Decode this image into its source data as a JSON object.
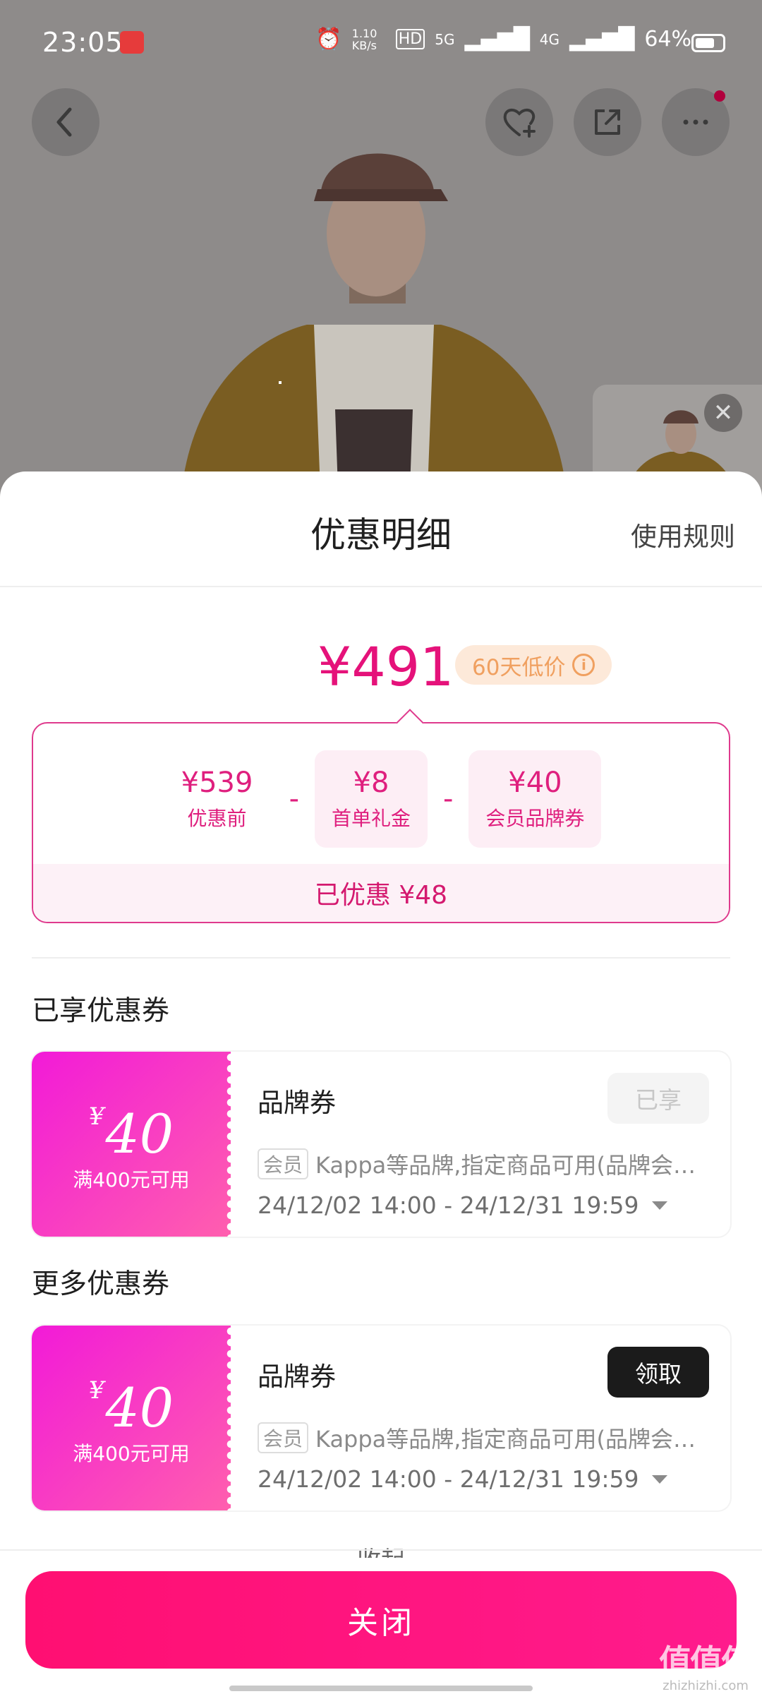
{
  "status_bar": {
    "time": "23:05",
    "net_speed": "1.10 KB/s",
    "network_labels": [
      "HD",
      "5G",
      "4G"
    ],
    "battery": "64%"
  },
  "header_icons": [
    "back-icon",
    "favorite-add-icon",
    "share-icon",
    "more-icon"
  ],
  "thumbnail": {
    "close_glyph": "✕"
  },
  "sheet": {
    "title": "优惠明细",
    "rules_link": "使用规则",
    "final_price": "¥491",
    "low_price_tag": "60天低价",
    "calc": {
      "items": [
        {
          "amount": "¥539",
          "label": "优惠前"
        },
        {
          "amount": "¥8",
          "label": "首单礼金"
        },
        {
          "amount": "¥40",
          "label": "会员品牌券"
        }
      ],
      "operator": "-",
      "saved": "已优惠 ¥48"
    },
    "sections": {
      "used_title": "已享优惠券",
      "more_title": "更多优惠券"
    },
    "coupons": [
      {
        "value_symbol": "¥",
        "value": "40",
        "condition": "满400元可用",
        "type": "品牌券",
        "button": "已享",
        "member_tag": "会员",
        "desc": "Kappa等品牌,指定商品可用(品牌会…",
        "date": "24/12/02 14:00 - 24/12/31 19:59"
      },
      {
        "value_symbol": "¥",
        "value": "40",
        "condition": "满400元可用",
        "type": "品牌券",
        "button": "领取",
        "member_tag": "会员",
        "desc": "Kappa等品牌,指定商品可用(品牌会…",
        "date": "24/12/02 14:00 - 24/12/31 19:59"
      }
    ],
    "collapse": "收起",
    "close_button": "关闭"
  },
  "watermark": {
    "main": "值值值",
    "sub": "zhizhizhi.com"
  },
  "colors": {
    "accent": "#e5127a",
    "coupon_gradient_start": "#f21ad8",
    "coupon_gradient_end": "#ff5fae",
    "close_button": "#ff0f72"
  }
}
